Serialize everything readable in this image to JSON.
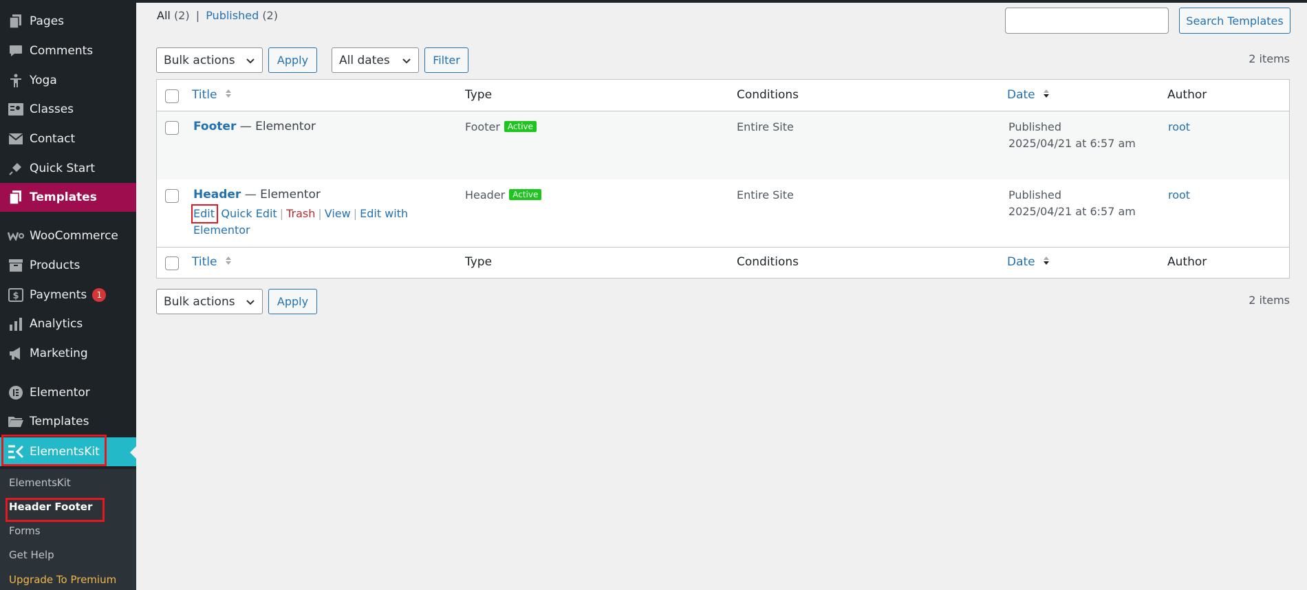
{
  "sidebar": {
    "items": [
      {
        "label": "Pages",
        "icon": "pages-icon"
      },
      {
        "label": "Comments",
        "icon": "comments-icon"
      },
      {
        "label": "Yoga",
        "icon": "person-icon"
      },
      {
        "label": "Classes",
        "icon": "id-card-icon"
      },
      {
        "label": "Contact",
        "icon": "envelope-icon"
      },
      {
        "label": "Quick Start",
        "icon": "plug-icon"
      },
      {
        "label": "Templates",
        "icon": "pages-icon"
      },
      {
        "label": "WooCommerce",
        "icon": "woo-icon"
      },
      {
        "label": "Products",
        "icon": "archive-icon"
      },
      {
        "label": "Payments",
        "icon": "dollar-icon",
        "badge": "1"
      },
      {
        "label": "Analytics",
        "icon": "bar-chart-icon"
      },
      {
        "label": "Marketing",
        "icon": "megaphone-icon"
      },
      {
        "label": "Elementor",
        "icon": "elementor-icon"
      },
      {
        "label": "Templates",
        "icon": "folder-icon"
      },
      {
        "label": "ElementsKit",
        "icon": "elementskit-icon"
      }
    ],
    "submenu": [
      "ElementsKit",
      "Header Footer",
      "Forms",
      "Get Help",
      "Upgrade To Premium"
    ]
  },
  "filters": {
    "all_label": "All",
    "all_count": "(2)",
    "published_label": "Published",
    "published_count": "(2)",
    "separator": "|"
  },
  "search": {
    "button": "Search Templates",
    "placeholder": ""
  },
  "toolbar": {
    "bulk_actions": "Bulk actions",
    "apply": "Apply",
    "all_dates": "All dates",
    "filter": "Filter",
    "items_count": "2 items"
  },
  "table": {
    "columns": {
      "title": "Title",
      "type": "Type",
      "conditions": "Conditions",
      "date": "Date",
      "author": "Author"
    },
    "rows": [
      {
        "title": "Footer",
        "suffix": "— Elementor",
        "type": "Footer",
        "status": "Active",
        "conditions": "Entire Site",
        "date_status": "Published",
        "date": "2025/04/21 at 6:57 am",
        "author": "root"
      },
      {
        "title": "Header",
        "suffix": "— Elementor",
        "type": "Header",
        "status": "Active",
        "conditions": "Entire Site",
        "date_status": "Published",
        "date": "2025/04/21 at 6:57 am",
        "author": "root"
      }
    ],
    "row_actions": {
      "edit": "Edit",
      "quick_edit": "Quick Edit",
      "trash": "Trash",
      "view": "View",
      "edit_with_1": "Edit with",
      "edit_with_2": "Elementor",
      "sep": "|"
    }
  },
  "colors": {
    "sidebar_bg": "#1d2327",
    "templates_active": "#9e0d4d",
    "elementskit_active": "#23b9c9",
    "link": "#2271b1",
    "active_badge": "#1ec51e",
    "highlight": "#e4181f"
  }
}
